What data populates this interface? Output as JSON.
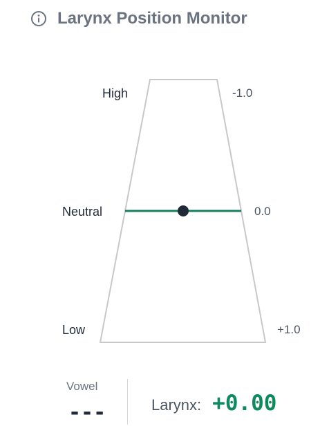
{
  "header": {
    "title": "Larynx Position Monitor",
    "icon": "info-icon"
  },
  "gauge": {
    "labels": {
      "high": "High",
      "neutral": "Neutral",
      "low": "Low"
    },
    "scale": {
      "top": "-1.0",
      "middle": "0.0",
      "bottom": "+1.0"
    },
    "range": [
      -1.0,
      1.0
    ],
    "current_position": 0.0,
    "colors": {
      "outline": "#c8c8c8",
      "indicator_line": "#15805a",
      "indicator_dot": "#1f2937"
    }
  },
  "footer": {
    "vowel_label": "Vowel",
    "vowel_value": "---",
    "larynx_label": "Larynx:",
    "larynx_value": "+0.00",
    "larynx_color": "#0f8a5f"
  }
}
